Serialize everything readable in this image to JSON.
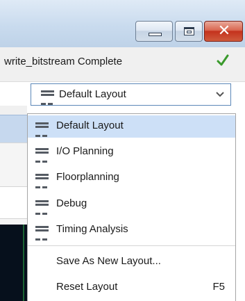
{
  "window": {
    "controls": [
      {
        "name": "minimize",
        "icon": "minimize-icon"
      },
      {
        "name": "maximize",
        "icon": "maximize-icon"
      },
      {
        "name": "close",
        "icon": "close-icon",
        "glyph": "✕"
      }
    ]
  },
  "status": {
    "text": "write_bitstream Complete",
    "icon": "checkmark-icon",
    "color": "#3a9a2c"
  },
  "layout_select": {
    "selected": "Default Layout",
    "icon": "layout-icon"
  },
  "dropdown": {
    "layouts": [
      {
        "label": "Default Layout",
        "highlighted": true
      },
      {
        "label": "I/O Planning"
      },
      {
        "label": "Floorplanning"
      },
      {
        "label": "Debug"
      },
      {
        "label": "Timing Analysis"
      }
    ],
    "actions": [
      {
        "label": "Save As New Layout..."
      },
      {
        "label": "Reset Layout",
        "shortcut": "F5"
      }
    ]
  },
  "colors": {
    "highlight": "#cde0f7",
    "select_border": "#5b87b8",
    "close_button": "#c4321d"
  }
}
